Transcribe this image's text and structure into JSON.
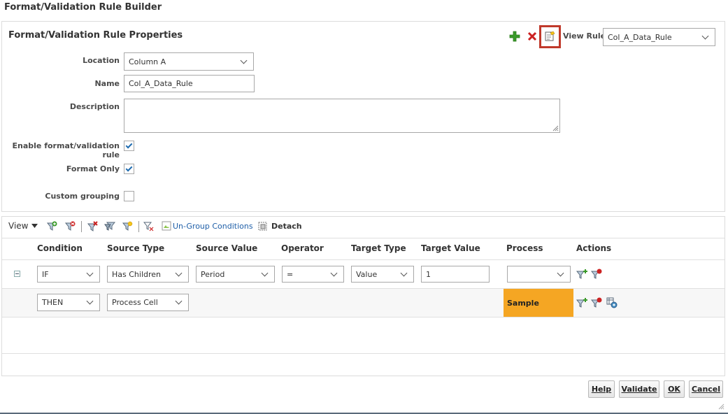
{
  "page_title": "Format/Validation Rule Builder",
  "properties": {
    "title": "Format/Validation Rule Properties",
    "view_rule_label": "View Rule",
    "view_rule_value": "Col_A_Data_Rule",
    "location_label": "Location",
    "location_value": "Column A",
    "name_label": "Name",
    "name_value": "Col_A_Data_Rule",
    "description_label": "Description",
    "description_value": "",
    "enable_label": "Enable format/validation rule",
    "enable_checked": true,
    "format_only_label": "Format Only",
    "format_only_checked": true,
    "custom_grouping_label": "Custom grouping",
    "custom_grouping_checked": false
  },
  "toolbar": {
    "view_label": "View",
    "ungroup_label": "Un-Group Conditions",
    "detach_label": "Detach"
  },
  "table": {
    "headers": [
      "Condition",
      "Source Type",
      "Source Value",
      "Operator",
      "Target Type",
      "Target Value",
      "Process",
      "Actions"
    ],
    "rows": [
      {
        "condition": "IF",
        "source_type": "Has Children",
        "source_value": "Period",
        "operator": "=",
        "target_type": "Value",
        "target_value": "1",
        "process": ""
      },
      {
        "condition": "THEN",
        "source_type": "Process Cell",
        "process": "Sample"
      }
    ]
  },
  "buttons": {
    "help": "Help",
    "validate": "Validate",
    "ok": "OK",
    "cancel": "Cancel"
  },
  "colors": {
    "process_highlight": "#f5a623",
    "highlight_border": "#c0392b",
    "add_green": "#3a9a2a",
    "delete_red": "#cc2222"
  }
}
